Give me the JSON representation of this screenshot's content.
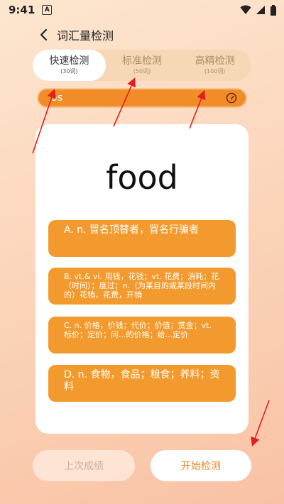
{
  "status_bar": {
    "time": "9:41",
    "notice": "A"
  },
  "header": {
    "title": "词汇量检测"
  },
  "modes": [
    {
      "name": "快速检测",
      "count": "(30词)"
    },
    {
      "name": "标准检测",
      "count": "(50词)"
    },
    {
      "name": "高精检测",
      "count": "(100词)"
    }
  ],
  "active_mode_index": 0,
  "timer": {
    "text": "5s"
  },
  "question": {
    "word": "food",
    "options": [
      "A. n. 冒名顶替者，冒名行骗者",
      "B. vt.& vi. 用钱，花钱；vt. 花费；消耗；花（时间）；度过；n.（为某目的或某段时间内的）花销，花费，开销",
      "C. n. 价格，价钱；代价；价值；赏金；vt. 标价；定价；问...的价格；给...定价",
      "D. n. 食物，食品；粮食；养料；资料"
    ]
  },
  "buttons": {
    "last_result": "上次成绩",
    "start": "开始检测"
  },
  "colors": {
    "accent": "#f28c28",
    "option_bg": "#f39a2e",
    "annotation": "#e02020"
  }
}
